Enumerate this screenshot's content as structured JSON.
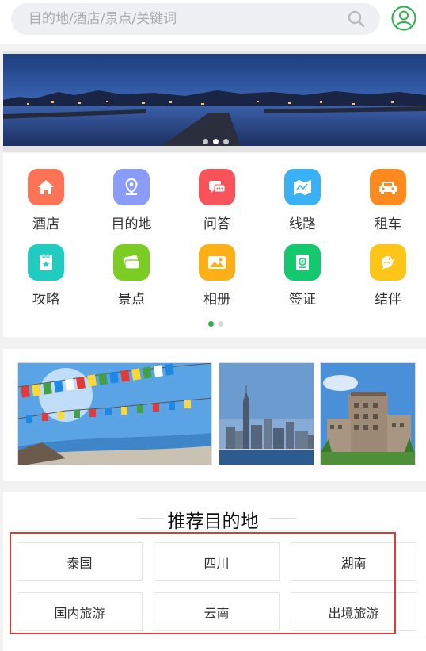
{
  "search": {
    "placeholder": "目的地/酒店/景点/关键词"
  },
  "icons": {
    "search": "search-icon",
    "user": "user-icon"
  },
  "banner": {
    "slides": 3,
    "active_slide": 2
  },
  "categories": [
    {
      "label": "酒店",
      "icon": "home-icon",
      "color": "#fc7356"
    },
    {
      "label": "目的地",
      "icon": "location-pin-icon",
      "color": "#8b9cf8"
    },
    {
      "label": "问答",
      "icon": "chat-bubble-icon",
      "color": "#f8525a"
    },
    {
      "label": "线路",
      "icon": "map-icon",
      "color": "#3ab0f5"
    },
    {
      "label": "租车",
      "icon": "car-icon",
      "color": "#fd8a1f"
    },
    {
      "label": "攻略",
      "icon": "guide-book-icon",
      "color": "#20cbbf"
    },
    {
      "label": "景点",
      "icon": "tickets-icon",
      "color": "#7ccd23"
    },
    {
      "label": "相册",
      "icon": "photo-icon",
      "color": "#fbb018"
    },
    {
      "label": "签证",
      "icon": "passport-icon",
      "color": "#14c86d"
    },
    {
      "label": "结伴",
      "icon": "bird-icon",
      "color": "#fdc517"
    }
  ],
  "category_pages": {
    "total": 2,
    "active": 1
  },
  "recommend": {
    "title": "推荐目的地",
    "tags": [
      "泰国",
      "四川",
      "湖南",
      "国内旅游",
      "云南",
      "出境旅游"
    ]
  },
  "colors": {
    "accent": "#2bb14a",
    "highlight": "#e53935"
  }
}
